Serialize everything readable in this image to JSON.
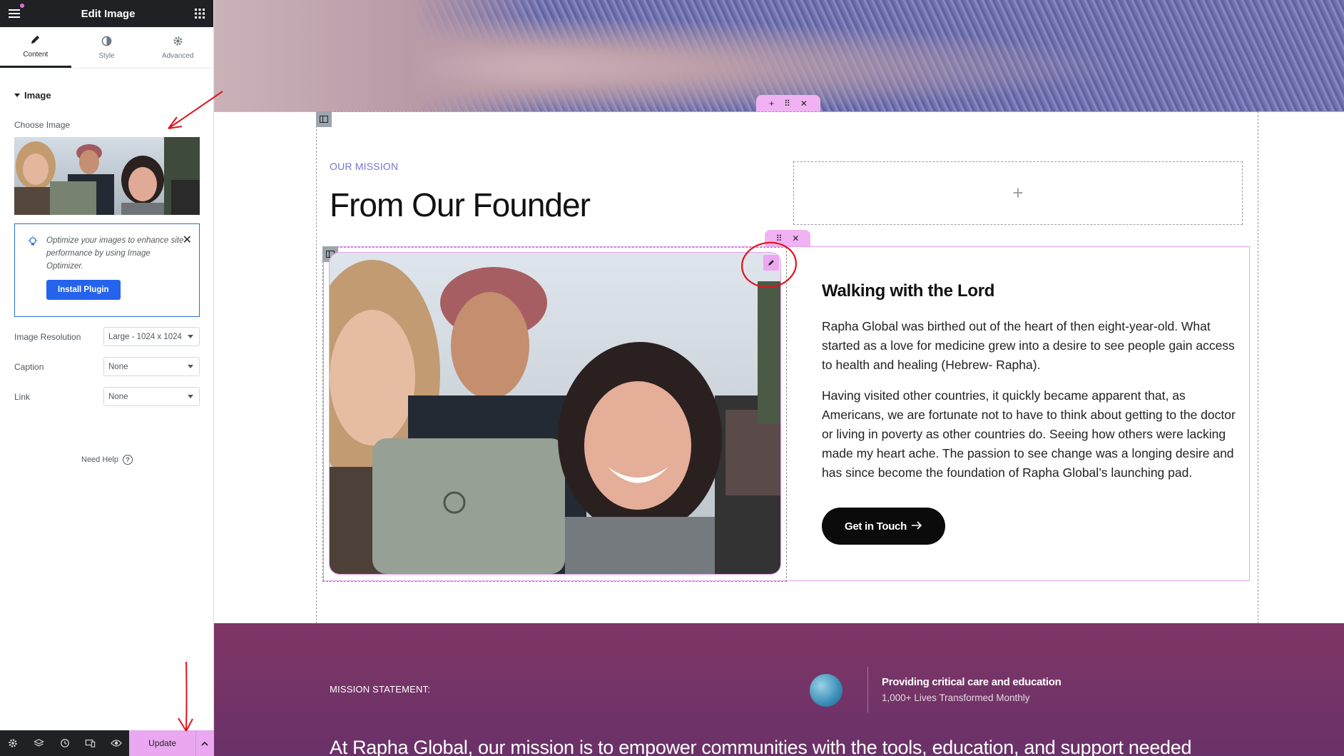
{
  "sidebar": {
    "title": "Edit Image",
    "tabs": [
      {
        "label": "Content",
        "active": true
      },
      {
        "label": "Style"
      },
      {
        "label": "Advanced"
      }
    ],
    "section_title": "Image",
    "choose_image_label": "Choose Image",
    "optimizer": {
      "text": "Optimize your images to enhance site performance by using Image Optimizer.",
      "button": "Install Plugin"
    },
    "controls": [
      {
        "label": "Image Resolution",
        "value": "Large - 1024 x 1024"
      },
      {
        "label": "Caption",
        "value": "None"
      },
      {
        "label": "Link",
        "value": "None"
      }
    ],
    "need_help": "Need Help",
    "footer": {
      "update_label": "Update",
      "icons": [
        "settings-icon",
        "layers-icon",
        "history-icon",
        "responsive-icon",
        "preview-icon"
      ]
    }
  },
  "canvas": {
    "mission_label": "OUR MISSION",
    "founder_title": "From Our Founder",
    "empty_slot_symbol": "+",
    "walk_title": "Walking with the Lord",
    "paragraphs": [
      "Rapha Global was birthed out of the heart of then eight-year-old. What started as a love for medicine grew into a desire to see people gain access to health and healing (Hebrew- Rapha).",
      "Having visited other countries, it quickly became apparent that, as Americans, we are fortunate not to have to think about getting to the doctor or living in poverty as other countries do. Seeing how others were lacking made my heart ache. The passion to see change was a longing desire and has since become the foundation of Rapha Global’s launching pad."
    ],
    "button_label": "Get in Touch",
    "band": {
      "label": "MISSION STATEMENT:",
      "feature_title": "Providing critical care and education",
      "feature_sub": "1,000+ Lives Transformed Monthly",
      "statement": "At Rapha Global, our mission is to empower communities with the tools, education, and support needed"
    }
  },
  "colors": {
    "accent_pink": "#e9a8ef",
    "primary_blue": "#2463eb",
    "mission_blue": "#6e78d6",
    "band_purple": "#7e3566",
    "dark": "#1f2124",
    "annotation_red": "#e0141c"
  }
}
